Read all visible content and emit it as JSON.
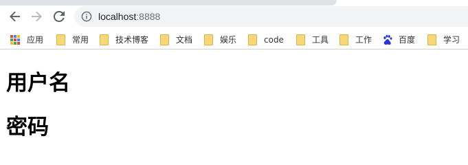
{
  "address_bar": {
    "url_host": "localhost",
    "url_port": ":8888"
  },
  "bookmarks": [
    {
      "label": "应用",
      "icon": "apps-grid-icon"
    },
    {
      "label": "常用",
      "icon": "folder-icon"
    },
    {
      "label": "技术博客",
      "icon": "folder-icon"
    },
    {
      "label": "文档",
      "icon": "folder-icon"
    },
    {
      "label": "娱乐",
      "icon": "folder-icon"
    },
    {
      "label": "code",
      "icon": "folder-icon"
    },
    {
      "label": "工具",
      "icon": "folder-icon"
    },
    {
      "label": "工作",
      "icon": "folder-icon"
    },
    {
      "label": "百度",
      "icon": "baidu-paw-icon"
    },
    {
      "label": "学习",
      "icon": "folder-icon"
    }
  ],
  "page": {
    "heading_username": "用户名",
    "heading_password": "密码"
  },
  "colors": {
    "omnibox_bg": "#f1f3f4",
    "folder_yellow": "#f8d776",
    "baidu_blue": "#2932e1"
  }
}
